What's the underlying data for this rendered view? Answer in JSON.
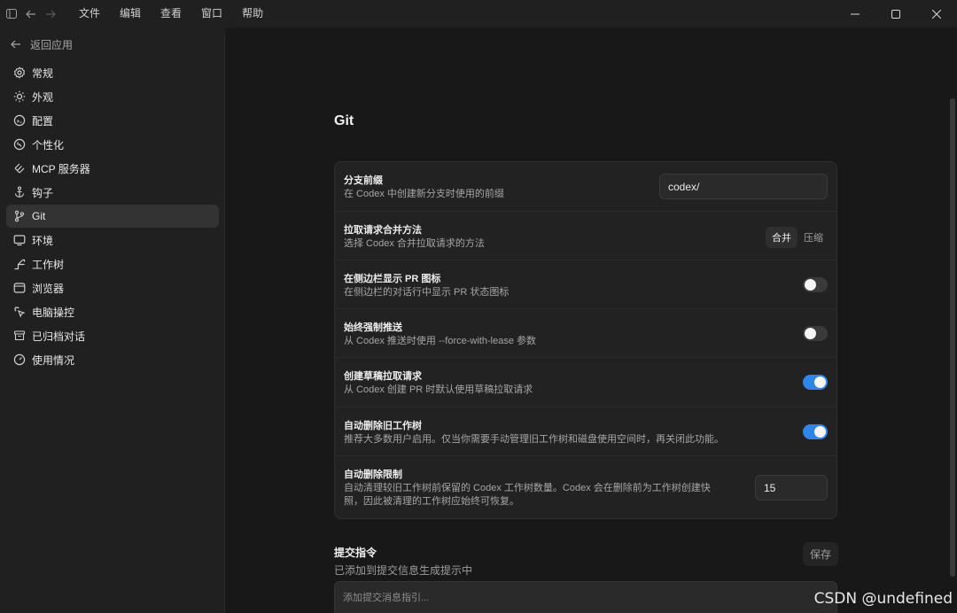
{
  "titlebar": {
    "menu": [
      "文件",
      "编辑",
      "查看",
      "窗口",
      "帮助"
    ],
    "icons": [
      "sidebar-toggle-icon",
      "back-arrow-icon",
      "forward-arrow-icon"
    ],
    "window_controls": [
      "minimize-icon",
      "maximize-icon",
      "close-icon"
    ]
  },
  "sidebar": {
    "back_label": "返回应用",
    "items": [
      {
        "label": "常规",
        "icon": "gear-icon"
      },
      {
        "label": "外观",
        "icon": "sun-icon"
      },
      {
        "label": "配置",
        "icon": "config-icon"
      },
      {
        "label": "个性化",
        "icon": "personalize-icon"
      },
      {
        "label": "MCP 服务器",
        "icon": "mcp-icon"
      },
      {
        "label": "钩子",
        "icon": "anchor-icon"
      },
      {
        "label": "Git",
        "icon": "git-branch-icon"
      },
      {
        "label": "环境",
        "icon": "monitor-icon"
      },
      {
        "label": "工作树",
        "icon": "worktree-icon"
      },
      {
        "label": "浏览器",
        "icon": "browser-icon"
      },
      {
        "label": "电脑操控",
        "icon": "pointer-icon"
      },
      {
        "label": "已归档对话",
        "icon": "archive-icon"
      },
      {
        "label": "使用情况",
        "icon": "gauge-icon"
      }
    ],
    "active_index": 6
  },
  "main": {
    "title": "Git",
    "settings": [
      {
        "title": "分支前缀",
        "desc": "在 Codex 中创建新分支时使用的前缀",
        "control": "input",
        "value": "codex/"
      },
      {
        "title": "拉取请求合并方法",
        "desc": "选择 Codex 合并拉取请求的方法",
        "control": "segmented",
        "options": [
          "合并",
          "压缩"
        ],
        "selected": 0
      },
      {
        "title": "在侧边栏显示 PR 图标",
        "desc": "在侧边栏的对话行中显示 PR 状态图标",
        "control": "toggle",
        "on": false
      },
      {
        "title": "始终强制推送",
        "desc": "从 Codex 推送时使用 --force-with-lease 参数",
        "control": "toggle",
        "on": false
      },
      {
        "title": "创建草稿拉取请求",
        "desc": "从 Codex 创建 PR 时默认使用草稿拉取请求",
        "control": "toggle",
        "on": true
      },
      {
        "title": "自动删除旧工作树",
        "desc": "推荐大多数用户启用。仅当你需要手动管理旧工作树和磁盘使用空间时，再关闭此功能。",
        "control": "toggle",
        "on": true
      },
      {
        "title": "自动删除限制",
        "desc_line1": "自动清理较旧工作树前保留的 Codex 工作树数量。Codex 会在删除前为工作树创建快",
        "desc_line2": "照，因此被清理的工作树应始终可恢复。",
        "control": "input",
        "value": "15"
      }
    ],
    "commit": {
      "title": "提交指令",
      "desc": "已添加到提交信息生成提示中",
      "save_label": "保存",
      "placeholder": "添加提交消息指引..."
    }
  },
  "watermark": "CSDN @undefined",
  "colors": {
    "accent": "#2f86e8",
    "background": "#181818",
    "sidebar": "#202020",
    "card": "#222222"
  }
}
